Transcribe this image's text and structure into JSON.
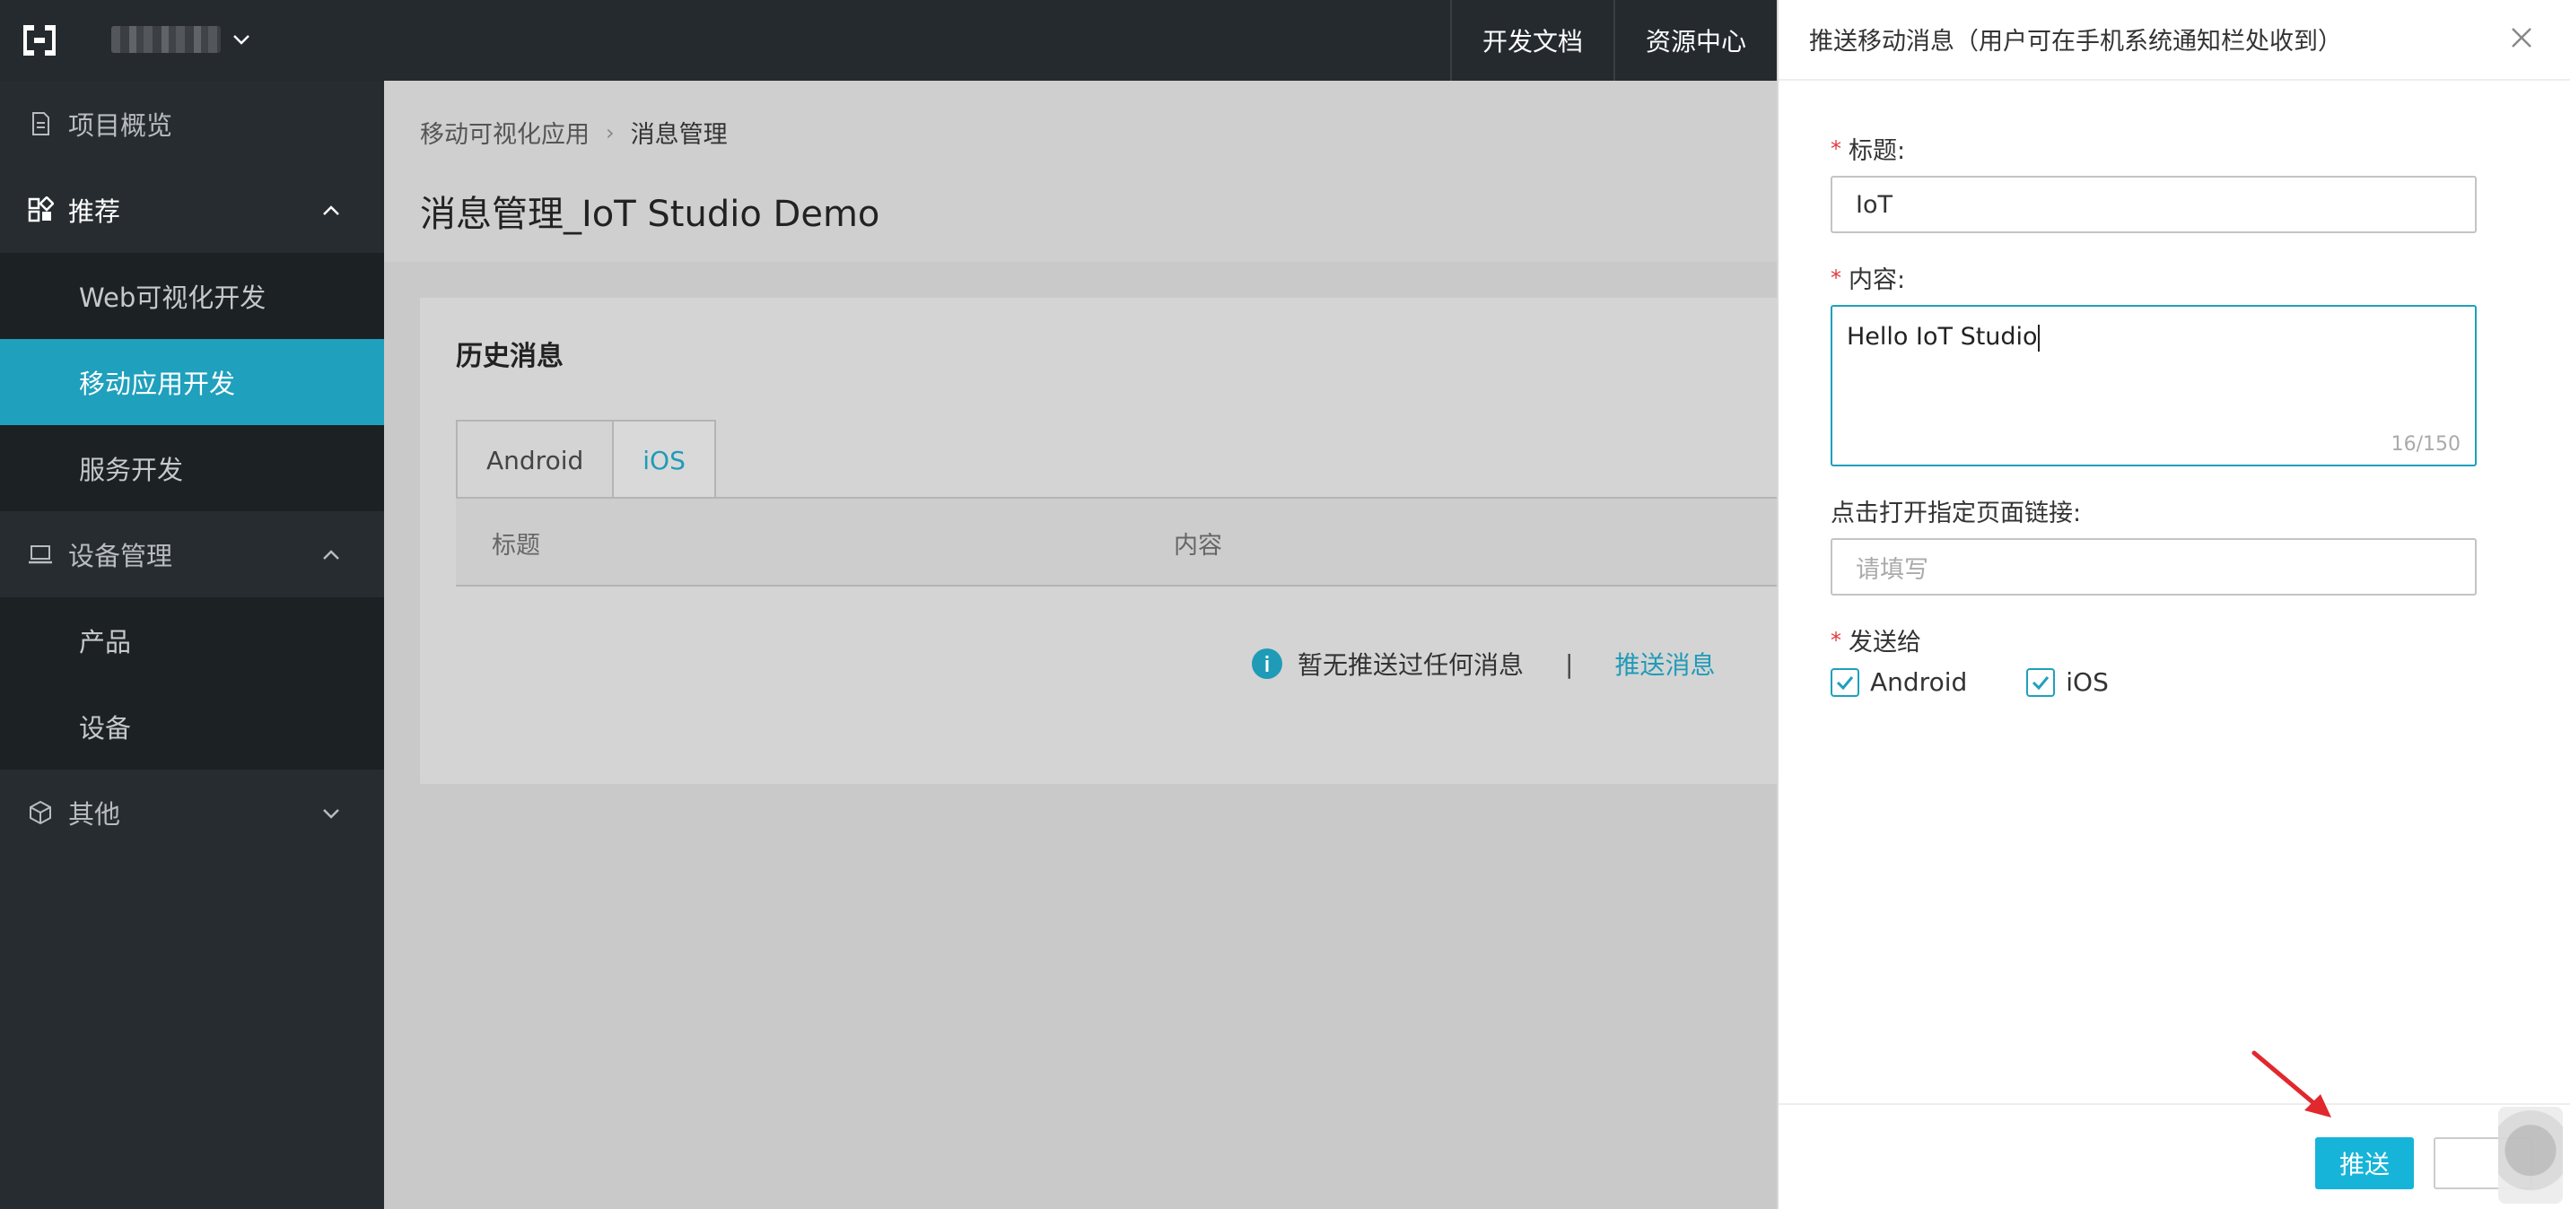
{
  "topbar": {
    "links": [
      "开发文档",
      "资源中心"
    ]
  },
  "sidebar": {
    "groups": [
      {
        "label": "项目概览"
      },
      {
        "label": "推荐",
        "items": [
          "Web可视化开发",
          "移动应用开发",
          "服务开发"
        ]
      },
      {
        "label": "设备管理",
        "items": [
          "产品",
          "设备"
        ]
      },
      {
        "label": "其他"
      }
    ],
    "active_item": "移动应用开发"
  },
  "breadcrumb": {
    "parent": "移动可视化应用",
    "current": "消息管理"
  },
  "page": {
    "title": "消息管理_IoT Studio Demo"
  },
  "history": {
    "title": "历史消息",
    "tabs": [
      "Android",
      "iOS"
    ],
    "active_tab": "iOS",
    "columns": [
      "标题",
      "内容"
    ],
    "empty_text": "暂无推送过任何消息",
    "divider": "|",
    "push_link": "推送消息"
  },
  "drawer": {
    "title": "推送移动消息（用户可在手机系统通知栏处收到）",
    "title_label": "标题:",
    "title_value": "IoT",
    "content_label": "内容:",
    "content_value": "Hello IoT Studio",
    "counter": "16/150",
    "link_label": "点击打开指定页面链接:",
    "link_placeholder": "请填写",
    "send_to_label": "发送给",
    "targets": [
      "Android",
      "iOS"
    ],
    "required_mark": "*",
    "push_button": "推送"
  },
  "colors": {
    "accent": "#1fa0bd",
    "button": "#16b4d8",
    "topbar": "#252a2f",
    "sidebar": "#262c30",
    "required": "#e4393c",
    "arrow": "#e0282e"
  }
}
